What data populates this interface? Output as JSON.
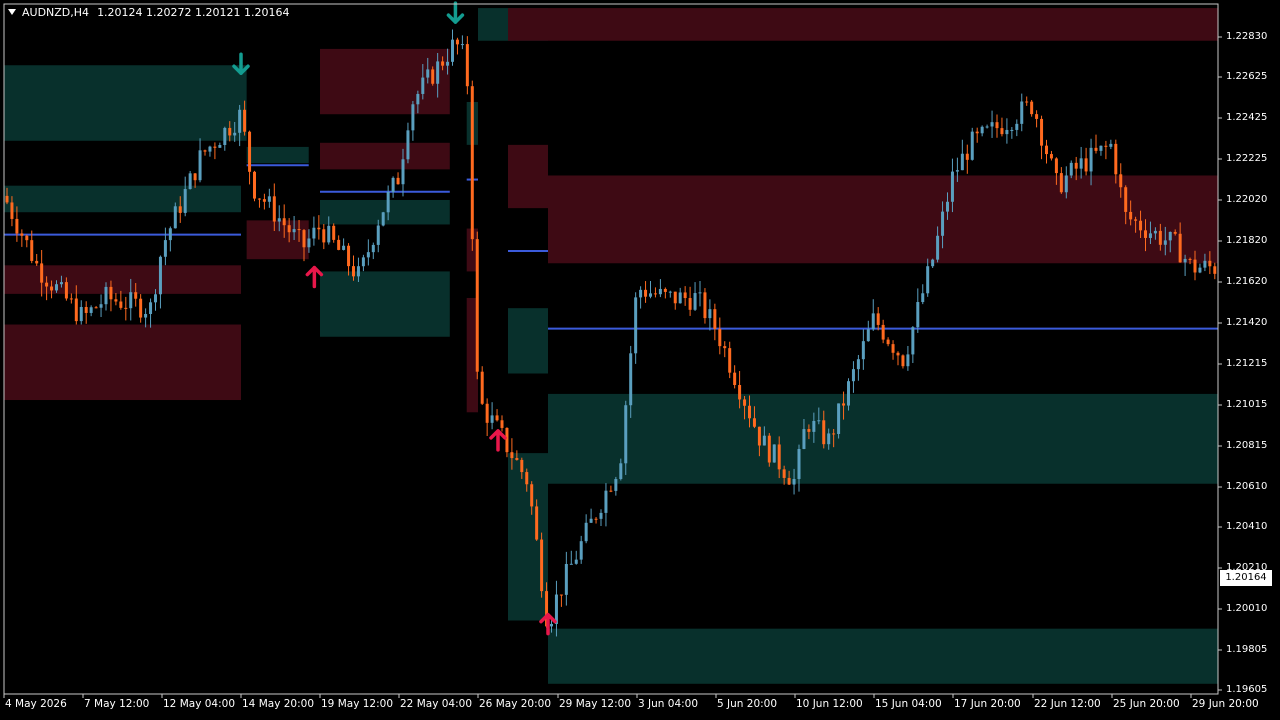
{
  "header": {
    "symbol": "AUDNZD,H4",
    "ohlc": "1.20124 1.20272 1.20121 1.20164"
  },
  "current_price": "1.20164",
  "colors": {
    "background": "#000000",
    "bull_candle": "#5a9fbf",
    "bear_candle": "#ff6a1f",
    "supply_zone": "#3e0a14",
    "demand_zone": "#08302c",
    "level_line": "#3b5bdb",
    "arrow_up": "#e8174a",
    "arrow_down": "#139c90"
  },
  "price_axis": [
    "1.22830",
    "1.22625",
    "1.22425",
    "1.22225",
    "1.22020",
    "1.21820",
    "1.21620",
    "1.21420",
    "1.21215",
    "1.21015",
    "1.20815",
    "1.20610",
    "1.20410",
    "1.20210",
    "1.20010",
    "1.19805",
    "1.19605"
  ],
  "time_axis": [
    "4 May 2026",
    "7 May 12:00",
    "12 May 04:00",
    "14 May 20:00",
    "19 May 12:00",
    "22 May 04:00",
    "26 May 20:00",
    "29 May 12:00",
    "3 Jun 04:00",
    "5 Jun 20:00",
    "10 Jun 12:00",
    "15 Jun 04:00",
    "17 Jun 20:00",
    "22 Jun 12:00",
    "25 Jun 20:00",
    "29 Jun 20:00"
  ],
  "chart_data": {
    "type": "candlestick",
    "title": "AUDNZD,H4",
    "ylim": [
      1.1956,
      1.2294
    ],
    "anchors": [
      [
        "4 May 2026",
        1.22
      ],
      [
        "5 May 12:00",
        1.2165
      ],
      [
        "7 May 12:00",
        1.214
      ],
      [
        "8 May 20:00",
        1.215
      ],
      [
        "11 May 12:00",
        1.2145
      ],
      [
        "12 May 04:00",
        1.2175
      ],
      [
        "13 May 12:00",
        1.222
      ],
      [
        "14 May 20:00",
        1.224
      ],
      [
        "15 May 12:00",
        1.2205
      ],
      [
        "18 May 12:00",
        1.2175
      ],
      [
        "19 May 12:00",
        1.2185
      ],
      [
        "20 May 20:00",
        1.216
      ],
      [
        "21 May 12:00",
        1.219
      ],
      [
        "22 May 04:00",
        1.221
      ],
      [
        "22 May 20:00",
        1.2245
      ],
      [
        "25 May 12:00",
        1.2275
      ],
      [
        "26 May 04:00",
        1.2265
      ],
      [
        "26 May 20:00",
        1.21
      ],
      [
        "27 May 12:00",
        1.2085
      ],
      [
        "28 May 12:00",
        1.206
      ],
      [
        "29 May 04:00",
        1.199
      ],
      [
        "29 May 12:00",
        1.2005
      ],
      [
        "2 Jun 04:00",
        1.207
      ],
      [
        "3 Jun 04:00",
        1.2155
      ],
      [
        "4 Jun 04:00",
        1.215
      ],
      [
        "5 Jun 04:00",
        1.215
      ],
      [
        "5 Jun 20:00",
        1.2135
      ],
      [
        "8 Jun 12:00",
        1.208
      ],
      [
        "10 Jun 12:00",
        1.206
      ],
      [
        "11 Jun 04:00",
        1.209
      ],
      [
        "12 Jun 12:00",
        1.208
      ],
      [
        "15 Jun 04:00",
        1.214
      ],
      [
        "16 Jun 04:00",
        1.212
      ],
      [
        "17 Jun 04:00",
        1.217
      ],
      [
        "17 Jun 20:00",
        1.221
      ],
      [
        "18 Jun 20:00",
        1.2225
      ],
      [
        "22 Jun 12:00",
        1.2245
      ],
      [
        "23 Jun 12:00",
        1.2205
      ],
      [
        "24 Jun 12:00",
        1.2215
      ],
      [
        "25 Jun 20:00",
        1.2225
      ],
      [
        "26 Jun 12:00",
        1.219
      ],
      [
        "29 Jun 04:00",
        1.2175
      ],
      [
        "29 Jun 20:00",
        1.2165
      ]
    ],
    "zones": [
      {
        "type": "demand",
        "from": "4 May 2026",
        "to": "15 May 04:00",
        "high": 1.2264,
        "low": 1.2227
      },
      {
        "type": "demand",
        "from": "4 May 2026",
        "to": "14 May 20:00",
        "high": 1.2205,
        "low": 1.2192
      },
      {
        "type": "supply",
        "from": "4 May 2026",
        "to": "14 May 20:00",
        "high": 1.2166,
        "low": 1.2152
      },
      {
        "type": "supply",
        "from": "4 May 2026",
        "to": "14 May 20:00",
        "high": 1.2137,
        "low": 1.21
      },
      {
        "type": "demand",
        "from": "15 May 04:00",
        "to": "18 May 20:00",
        "high": 1.2224,
        "low": 1.2216
      },
      {
        "type": "supply",
        "from": "15 May 04:00",
        "to": "18 May 20:00",
        "high": 1.2188,
        "low": 1.2169
      },
      {
        "type": "supply",
        "from": "19 May 12:00",
        "to": "25 May 04:00",
        "high": 1.2272,
        "low": 1.224
      },
      {
        "type": "supply",
        "from": "19 May 12:00",
        "to": "25 May 04:00",
        "high": 1.2226,
        "low": 1.2213
      },
      {
        "type": "demand",
        "from": "19 May 12:00",
        "to": "25 May 04:00",
        "high": 1.2198,
        "low": 1.2186
      },
      {
        "type": "demand",
        "from": "19 May 12:00",
        "to": "25 May 04:00",
        "high": 1.2163,
        "low": 1.2131
      },
      {
        "type": "supply",
        "from": "26 May 04:00",
        "to": "26 May 20:00",
        "high": 1.2184,
        "low": 1.2163
      },
      {
        "type": "demand",
        "from": "26 May 04:00",
        "to": "26 May 20:00",
        "high": 1.2246,
        "low": 1.2225
      },
      {
        "type": "supply",
        "from": "26 May 04:00",
        "to": "26 May 20:00",
        "high": 1.215,
        "low": 1.2094
      },
      {
        "type": "demand",
        "from": "26 May 20:00",
        "to": "29 May 04:00",
        "high": 1.2292,
        "low": 1.2276
      },
      {
        "type": "supply",
        "from": "27 May 20:00",
        "to": "29 May 04:00",
        "high": 1.2292,
        "low": 1.2276
      },
      {
        "type": "supply",
        "from": "27 May 20:00",
        "to": "29 May 04:00",
        "high": 1.2225,
        "low": 1.2194
      },
      {
        "type": "demand",
        "from": "27 May 20:00",
        "to": "29 May 04:00",
        "high": 1.2145,
        "low": 1.2113
      },
      {
        "type": "demand",
        "from": "27 May 20:00",
        "to": "29 May 04:00",
        "high": 1.2074,
        "low": 1.1992
      },
      {
        "type": "supply",
        "from": "29 May 04:00",
        "to": "end",
        "high": 1.2292,
        "low": 1.2276
      },
      {
        "type": "supply",
        "from": "29 May 04:00",
        "to": "end",
        "high": 1.221,
        "low": 1.2167
      },
      {
        "type": "demand",
        "from": "29 May 04:00",
        "to": "end",
        "high": 1.2103,
        "low": 1.2059
      },
      {
        "type": "demand",
        "from": "29 May 04:00",
        "to": "end",
        "high": 1.1988,
        "low": 1.1961
      }
    ],
    "levels": [
      {
        "price": 1.2181,
        "from": "4 May 2026",
        "to": "14 May 20:00"
      },
      {
        "price": 1.2215,
        "from": "15 May 04:00",
        "to": "18 May 20:00"
      },
      {
        "price": 1.2202,
        "from": "19 May 12:00",
        "to": "25 May 04:00"
      },
      {
        "price": 1.2208,
        "from": "26 May 04:00",
        "to": "26 May 20:00"
      },
      {
        "price": 1.2173,
        "from": "27 May 20:00",
        "to": "29 May 04:00"
      },
      {
        "price": 1.2135,
        "from": "29 May 04:00",
        "to": "end"
      }
    ],
    "signals": [
      {
        "type": "sell",
        "time": "14 May 20:00",
        "price": 1.2265
      },
      {
        "type": "buy",
        "time": "19 May 04:00",
        "price": 1.216
      },
      {
        "type": "sell",
        "time": "25 May 12:00",
        "price": 1.229
      },
      {
        "type": "buy",
        "time": "27 May 12:00",
        "price": 1.208
      },
      {
        "type": "buy",
        "time": "29 May 04:00",
        "price": 1.199
      }
    ],
    "last_price": 1.20164
  }
}
